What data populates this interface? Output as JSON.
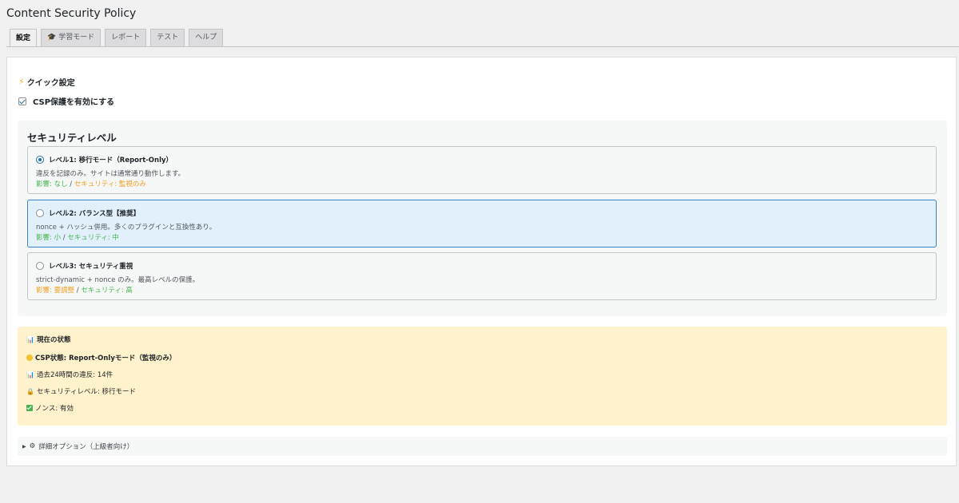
{
  "page": {
    "title": "Content Security Policy"
  },
  "tabs": [
    {
      "label": "設定",
      "active": true,
      "icon": ""
    },
    {
      "label": "学習モード",
      "active": false,
      "icon": "graduation-cap-icon"
    },
    {
      "label": "レポート",
      "active": false,
      "icon": ""
    },
    {
      "label": "テスト",
      "active": false,
      "icon": ""
    },
    {
      "label": "ヘルプ",
      "active": false,
      "icon": ""
    }
  ],
  "quick": {
    "heading": "クイック設定",
    "icon": "lightning-icon",
    "enable_label": "CSP保護を有効にする",
    "enabled": true
  },
  "levels": {
    "heading": "セキュリティレベル",
    "options": [
      {
        "title": "レベル1: 移行モード（Report-Only）",
        "desc": "違反を記録のみ。サイトは通常通り動作します。",
        "impact": "影響: なし",
        "security": "セキュリティ: 監視のみ",
        "checked": true
      },
      {
        "title": "レベル2: バランス型【推奨】",
        "desc": "nonce + ハッシュ併用。多くのプラグインと互換性あり。",
        "impact": "影響: 小",
        "security": "セキュリティ: 中",
        "checked": false
      },
      {
        "title": "レベル3: セキュリティ重視",
        "desc": "strict-dynamic + nonce のみ。最高レベルの保護。",
        "impact": "影響: 要調整",
        "security": "セキュリティ: 高",
        "checked": false
      }
    ],
    "separator": "/"
  },
  "status": {
    "heading": "現在の状態",
    "csp_state": "CSP状態: Report-Onlyモード（監視のみ）",
    "violations": "過去24時間の違反: 14件",
    "level": "セキュリティレベル: 移行モード",
    "nonce": "ノンス: 有効"
  },
  "advanced": {
    "label": "詳細オプション（上級者向け）",
    "icon": "gear-icon"
  },
  "colors": {
    "accent": "#2271b1",
    "good": "#46b450",
    "warn": "#f0a020",
    "status_bg": "#fff2cc"
  }
}
